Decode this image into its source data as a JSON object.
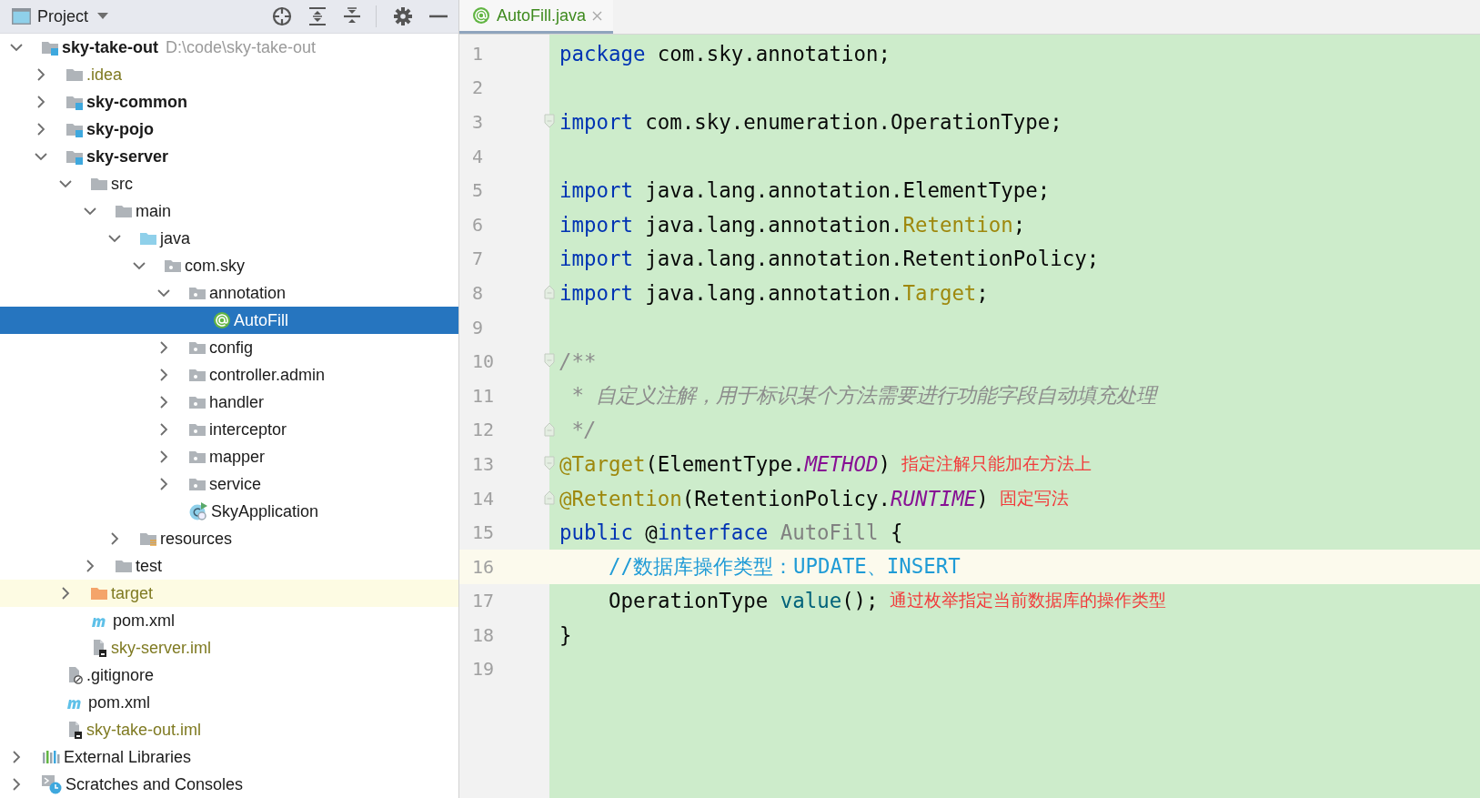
{
  "project": {
    "title": "Project",
    "tree": [
      {
        "label": "sky-take-out",
        "kind": "module",
        "path": "D:\\code\\sky-take-out",
        "expanded": true,
        "selected": false,
        "highlighted": false,
        "ignored": false,
        "children": [
          {
            "label": ".idea",
            "kind": "folder",
            "expanded": false,
            "selected": false,
            "highlighted": false,
            "ignored": true
          },
          {
            "label": "sky-common",
            "kind": "module",
            "expanded": false,
            "selected": false,
            "highlighted": false,
            "ignored": false
          },
          {
            "label": "sky-pojo",
            "kind": "module",
            "expanded": false,
            "selected": false,
            "highlighted": false,
            "ignored": false
          },
          {
            "label": "sky-server",
            "kind": "module",
            "expanded": true,
            "selected": false,
            "highlighted": false,
            "ignored": false,
            "children": [
              {
                "label": "src",
                "kind": "folder",
                "expanded": true,
                "selected": false,
                "highlighted": false,
                "ignored": false,
                "children": [
                  {
                    "label": "main",
                    "kind": "folder",
                    "expanded": true,
                    "selected": false,
                    "highlighted": false,
                    "ignored": false,
                    "children": [
                      {
                        "label": "java",
                        "kind": "source",
                        "expanded": true,
                        "selected": false,
                        "highlighted": false,
                        "ignored": false,
                        "children": [
                          {
                            "label": "com.sky",
                            "kind": "package",
                            "expanded": true,
                            "selected": false,
                            "highlighted": false,
                            "ignored": false,
                            "children": [
                              {
                                "label": "annotation",
                                "kind": "package",
                                "expanded": true,
                                "selected": false,
                                "highlighted": false,
                                "ignored": false,
                                "children": [
                                  {
                                    "label": "AutoFill",
                                    "kind": "annotation",
                                    "selected": true,
                                    "highlighted": false,
                                    "ignored": false
                                  }
                                ]
                              },
                              {
                                "label": "config",
                                "kind": "package",
                                "expanded": false,
                                "selected": false,
                                "highlighted": false,
                                "ignored": false
                              },
                              {
                                "label": "controller.admin",
                                "kind": "package",
                                "expanded": false,
                                "selected": false,
                                "highlighted": false,
                                "ignored": false
                              },
                              {
                                "label": "handler",
                                "kind": "package",
                                "expanded": false,
                                "selected": false,
                                "highlighted": false,
                                "ignored": false
                              },
                              {
                                "label": "interceptor",
                                "kind": "package",
                                "expanded": false,
                                "selected": false,
                                "highlighted": false,
                                "ignored": false
                              },
                              {
                                "label": "mapper",
                                "kind": "package",
                                "expanded": false,
                                "selected": false,
                                "highlighted": false,
                                "ignored": false
                              },
                              {
                                "label": "service",
                                "kind": "package",
                                "expanded": false,
                                "selected": false,
                                "highlighted": false,
                                "ignored": false
                              },
                              {
                                "label": "SkyApplication",
                                "kind": "spring-class",
                                "selected": false,
                                "highlighted": false,
                                "ignored": false
                              }
                            ]
                          }
                        ]
                      },
                      {
                        "label": "resources",
                        "kind": "resources",
                        "expanded": false,
                        "selected": false,
                        "highlighted": false,
                        "ignored": false
                      }
                    ]
                  },
                  {
                    "label": "test",
                    "kind": "folder",
                    "expanded": false,
                    "selected": false,
                    "highlighted": false,
                    "ignored": false
                  }
                ]
              },
              {
                "label": "target",
                "kind": "excluded",
                "expanded": false,
                "selected": false,
                "highlighted": true,
                "ignored": true
              },
              {
                "label": "pom.xml",
                "kind": "maven",
                "selected": false,
                "highlighted": false,
                "ignored": false
              },
              {
                "label": "sky-server.iml",
                "kind": "iml",
                "selected": false,
                "highlighted": false,
                "ignored": true
              }
            ]
          },
          {
            "label": ".gitignore",
            "kind": "gitignore",
            "selected": false,
            "highlighted": false,
            "ignored": false
          },
          {
            "label": "pom.xml",
            "kind": "maven",
            "selected": false,
            "highlighted": false,
            "ignored": false
          },
          {
            "label": "sky-take-out.iml",
            "kind": "iml",
            "selected": false,
            "highlighted": false,
            "ignored": true
          }
        ]
      },
      {
        "label": "External Libraries",
        "kind": "libraries",
        "expanded": false,
        "selected": false,
        "highlighted": false,
        "ignored": false
      },
      {
        "label": "Scratches and Consoles",
        "kind": "scratches",
        "expanded": false,
        "selected": false,
        "highlighted": false,
        "ignored": false
      }
    ]
  },
  "editor": {
    "tabs": [
      {
        "label": "AutoFill.java",
        "selected": true
      }
    ],
    "lines": [
      {
        "number": "1",
        "current": false,
        "indented": false,
        "fold_open": false,
        "fold_close": false,
        "tokens": [
          {
            "kind": "keyword",
            "text": "package"
          },
          {
            "kind": "plain",
            "text": " com.sky.annotation;"
          }
        ]
      },
      {
        "number": "2",
        "current": false,
        "fold_open": false,
        "fold_close": false
      },
      {
        "number": "3",
        "current": false,
        "indented": false,
        "fold_open": true,
        "fold_close": false,
        "tokens": [
          {
            "kind": "keyword",
            "text": "import"
          },
          {
            "kind": "plain",
            "text": " com.sky.enumeration.OperationType;"
          }
        ]
      },
      {
        "number": "4",
        "current": false,
        "fold_open": false,
        "fold_close": false
      },
      {
        "number": "5",
        "current": false,
        "indented": false,
        "fold_open": false,
        "fold_close": false,
        "tokens": [
          {
            "kind": "keyword",
            "text": "import"
          },
          {
            "kind": "plain",
            "text": " java.lang.annotation.ElementType;"
          }
        ]
      },
      {
        "number": "6",
        "current": false,
        "indented": false,
        "fold_open": false,
        "fold_close": false,
        "tokens": [
          {
            "kind": "keyword",
            "text": "import"
          },
          {
            "kind": "plain",
            "text": " java.lang.annotation."
          },
          {
            "kind": "annotation",
            "text": "Retention"
          },
          {
            "kind": "plain",
            "text": ";"
          }
        ]
      },
      {
        "number": "7",
        "current": false,
        "indented": false,
        "fold_open": false,
        "fold_close": false,
        "tokens": [
          {
            "kind": "keyword",
            "text": "import"
          },
          {
            "kind": "plain",
            "text": " java.lang.annotation.RetentionPolicy;"
          }
        ]
      },
      {
        "number": "8",
        "current": false,
        "indented": false,
        "fold_open": false,
        "fold_close": true,
        "tokens": [
          {
            "kind": "keyword",
            "text": "import"
          },
          {
            "kind": "plain",
            "text": " java.lang.annotation."
          },
          {
            "kind": "annotation",
            "text": "Target"
          },
          {
            "kind": "plain",
            "text": ";"
          }
        ]
      },
      {
        "number": "9",
        "current": false,
        "fold_open": false,
        "fold_close": false
      },
      {
        "number": "10",
        "current": false,
        "indented": false,
        "fold_open": true,
        "fold_close": false,
        "tokens": [
          {
            "kind": "comment",
            "text": "/**"
          }
        ]
      },
      {
        "number": "11",
        "current": false,
        "indented": false,
        "fold_open": false,
        "fold_close": false,
        "tokens": [
          {
            "kind": "comment",
            "text": " * 自定义注解，用于标识某个方法需要进行功能字段自动填充处理"
          }
        ]
      },
      {
        "number": "12",
        "current": false,
        "indented": false,
        "fold_open": false,
        "fold_close": true,
        "tokens": [
          {
            "kind": "comment",
            "text": " */"
          }
        ]
      },
      {
        "number": "13",
        "current": false,
        "indented": false,
        "fold_open": true,
        "fold_close": false,
        "tokens": [
          {
            "kind": "annotation",
            "text": "@Target"
          },
          {
            "kind": "plain",
            "text": "(ElementType."
          },
          {
            "kind": "constant",
            "text": "METHOD"
          },
          {
            "kind": "plain",
            "text": ")"
          }
        ],
        "note": "指定注解只能加在方法上"
      },
      {
        "number": "14",
        "current": false,
        "indented": false,
        "fold_open": false,
        "fold_close": true,
        "tokens": [
          {
            "kind": "annotation",
            "text": "@Retention"
          },
          {
            "kind": "plain",
            "text": "(RetentionPolicy."
          },
          {
            "kind": "constant",
            "text": "RUNTIME"
          },
          {
            "kind": "plain",
            "text": ")"
          }
        ],
        "note": "固定写法"
      },
      {
        "number": "15",
        "current": false,
        "indented": false,
        "fold_open": false,
        "fold_close": false,
        "tokens": [
          {
            "kind": "keyword",
            "text": "public"
          },
          {
            "kind": "plain",
            "text": " @"
          },
          {
            "kind": "keyword",
            "text": "interface"
          },
          {
            "kind": "unused",
            "text": " AutoFill"
          },
          {
            "kind": "plain",
            "text": " {"
          }
        ]
      },
      {
        "number": "16",
        "current": true,
        "indented": true,
        "fold_open": false,
        "fold_close": false,
        "tokens": [
          {
            "kind": "doc-comment",
            "text": "//数据库操作类型：UPDATE、INSERT"
          }
        ]
      },
      {
        "number": "17",
        "current": false,
        "indented": true,
        "fold_open": false,
        "fold_close": false,
        "tokens": [
          {
            "kind": "plain",
            "text": "OperationType "
          },
          {
            "kind": "method",
            "text": "value"
          },
          {
            "kind": "plain",
            "text": "();"
          }
        ],
        "note": "通过枚举指定当前数据库的操作类型"
      },
      {
        "number": "18",
        "current": false,
        "indented": false,
        "fold_open": false,
        "fold_close": false,
        "tokens": [
          {
            "kind": "plain",
            "text": "}"
          }
        ]
      },
      {
        "number": "19",
        "current": false,
        "fold_open": false,
        "fold_close": false
      }
    ]
  }
}
